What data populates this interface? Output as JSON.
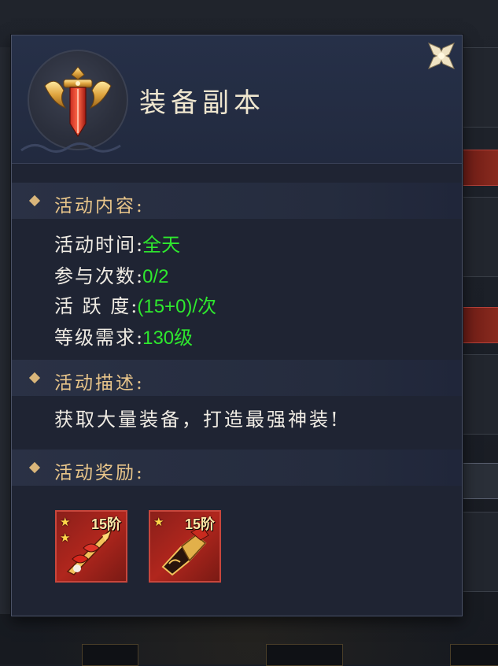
{
  "popup": {
    "title": "装备副本",
    "close_icon": "close-x-icon"
  },
  "sections": {
    "content": {
      "label": "活动内容:",
      "rows": [
        {
          "key": "活动时间",
          "sep": ":",
          "value": "全天"
        },
        {
          "key": "参与次数",
          "sep": ":",
          "value": "0/2"
        },
        {
          "key": "活 跃 度",
          "sep": ":",
          "value": "(15+0)/次"
        },
        {
          "key": "等级需求",
          "sep": ":",
          "value": "130级"
        }
      ]
    },
    "description": {
      "label": "活动描述:",
      "text": "获取大量装备，打造最强神装!"
    },
    "rewards": {
      "label": "活动奖励:",
      "items": [
        {
          "tier": "15阶",
          "stars": 2,
          "icon": "red-sword-icon"
        },
        {
          "tier": "15阶",
          "stars": 1,
          "icon": "gold-gauntlet-icon"
        }
      ]
    }
  },
  "colors": {
    "accent_gold": "#e8c58a",
    "value_green": "#2ee82e",
    "panel_bg": "#1f2433",
    "reward_red": "#b0261d"
  }
}
